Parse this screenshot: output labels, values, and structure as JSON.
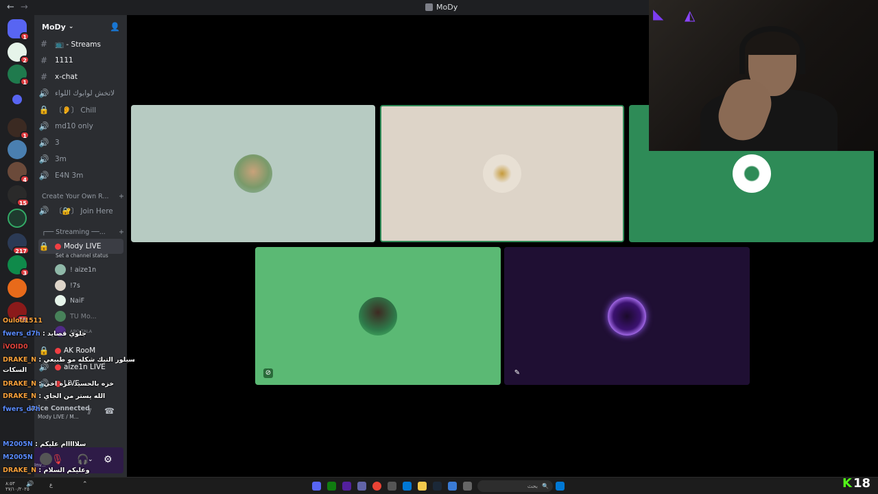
{
  "window": {
    "title": "MoDy"
  },
  "guilds": {
    "badges": [
      "1",
      "2",
      "1",
      "1",
      "4",
      "15",
      "217",
      "3",
      "15"
    ]
  },
  "server": {
    "name": "MoDy"
  },
  "channels": [
    {
      "icon": "hash-icon",
      "label": "📺 - Streams"
    },
    {
      "icon": "hash-icon",
      "label": "1111"
    },
    {
      "icon": "hash-icon",
      "label": "x-chat"
    },
    {
      "icon": "speaker-icon",
      "label": "لاتخش لوابوك اللواء"
    },
    {
      "icon": "lock-icon",
      "label": "〔👂〕 Chill"
    },
    {
      "icon": "speaker-icon",
      "label": "md10 only"
    },
    {
      "icon": "speaker-icon",
      "label": "3"
    },
    {
      "icon": "speaker-icon",
      "label": "3m"
    },
    {
      "icon": "speaker-icon",
      "label": "E4N 3m"
    }
  ],
  "category_create": "Create Your Own R...",
  "join_here": "〔🔐〕 Join Here",
  "category_streaming": "┌── Streaming ──...",
  "live_channel": {
    "label": "Mody LIVE",
    "status": "Set a channel status"
  },
  "voice_users": [
    "! aize1n",
    "!7s",
    "NaiF",
    "TU Mo...",
    "ABO TALA"
  ],
  "more_channels": [
    "AK RooM",
    "aize1n LIVE",
    "LIVE"
  ],
  "voice_connected": {
    "label": "Voice Connected",
    "sub": "Mody LIVE / M..."
  },
  "user_panel": {
    "name": "Inv..."
  },
  "chat": [
    {
      "name": "Oulou1511",
      "msg": "",
      "color": "orange"
    },
    {
      "name": "fwers_d7h",
      "msg": ": جلوي قصايد",
      "color": "blue"
    },
    {
      "name": "iVOID0",
      "msg": "",
      "color": "red"
    },
    {
      "name": "DRAKE_N",
      "msg": ": هذا الكسبلور التيك شكله مو طبيعي",
      "color": "orange"
    },
    {
      "name": "",
      "msg": "السكات",
      "color": "white"
    },
    {
      "name": "DRAKE_N",
      "msg": ": خزه بالحسيد عره اخي",
      "color": "orange"
    },
    {
      "name": "DRAKE_N",
      "msg": ": الله يستر من الجاي",
      "color": "orange"
    },
    {
      "name": "fwers_d7h",
      "msg": "",
      "color": "blue"
    },
    {
      "name": "M2005N",
      "msg": ": سلااااام عليكم",
      "color": "blue"
    },
    {
      "name": "M2005N",
      "msg": "",
      "color": "blue"
    },
    {
      "name": "DRAKE_N",
      "msg": ": وعليكم السلام",
      "color": "orange"
    }
  ],
  "tiles": [
    {
      "bg": "#b7cbc2",
      "avatar_bg": "#8fb8a8"
    },
    {
      "bg": "#ddd4c8",
      "avatar_bg": "#e8e0d4"
    },
    {
      "bg": "#2e8b57",
      "avatar_bg": "#ffffff"
    },
    {
      "bg": "#5bb974",
      "avatar_bg": "#3a7a4a"
    },
    {
      "bg": "#1f0f33",
      "avatar_bg": "#6a2bbf"
    }
  ],
  "taskbar": {
    "search_placeholder": "بحث",
    "time": "٨:٥٣",
    "date": "٢٧/١٠/٢٠٢٥"
  },
  "overlay": {
    "viewers": "18"
  }
}
